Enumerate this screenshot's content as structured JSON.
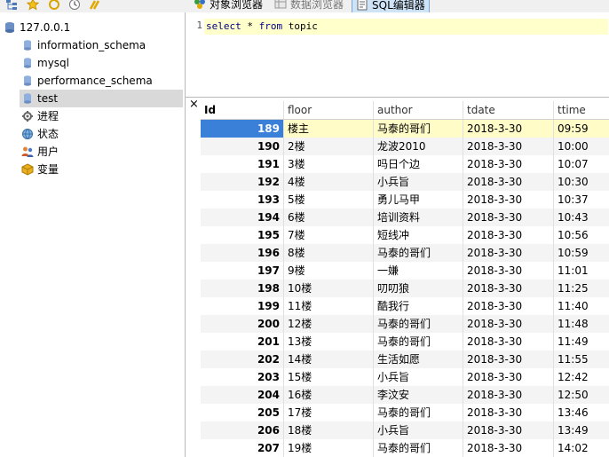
{
  "toolbar": {
    "icons": [
      "connection-tree-icon",
      "favorites-star-icon",
      "refresh-icon",
      "history-clock-icon",
      "tools-icon"
    ],
    "buttons": [
      {
        "label": "对象浏览器",
        "icon": "object-browser-icon",
        "state": "normal"
      },
      {
        "label": "数据浏览器",
        "icon": "data-browser-icon",
        "state": "disabled"
      },
      {
        "label": "SQL编辑器",
        "icon": "sql-editor-icon",
        "state": "active"
      }
    ]
  },
  "tree": {
    "server": "127.0.0.1",
    "databases": [
      "information_schema",
      "mysql",
      "performance_schema",
      "test"
    ],
    "selected_database": "test",
    "nodes": [
      "进程",
      "状态",
      "用户",
      "变量"
    ]
  },
  "editor": {
    "line_number": "1",
    "sql": {
      "select": "select",
      "star": "*",
      "from": "from",
      "table": "topic"
    }
  },
  "results": {
    "close": "×",
    "columns": [
      "Id",
      "floor",
      "author",
      "tdate",
      "ttime"
    ],
    "rows": [
      [
        "189",
        "楼主",
        "马泰的哥们",
        "2018-3-30",
        "09:59"
      ],
      [
        "190",
        "2楼",
        "龙波2010",
        "2018-3-30",
        "10:00"
      ],
      [
        "191",
        "3楼",
        "吗日个边",
        "2018-3-30",
        "10:07"
      ],
      [
        "192",
        "4楼",
        "小兵旨",
        "2018-3-30",
        "10:30"
      ],
      [
        "193",
        "5楼",
        "勇儿马甲",
        "2018-3-30",
        "10:37"
      ],
      [
        "194",
        "6楼",
        "培训资料",
        "2018-3-30",
        "10:43"
      ],
      [
        "195",
        "7楼",
        "短线冲",
        "2018-3-30",
        "10:56"
      ],
      [
        "196",
        "8楼",
        "马泰的哥们",
        "2018-3-30",
        "10:59"
      ],
      [
        "197",
        "9楼",
        "一嫌",
        "2018-3-30",
        "11:01"
      ],
      [
        "198",
        "10楼",
        "叨叨狼",
        "2018-3-30",
        "11:25"
      ],
      [
        "199",
        "11楼",
        "酷我行",
        "2018-3-30",
        "11:40"
      ],
      [
        "200",
        "12楼",
        "马泰的哥们",
        "2018-3-30",
        "11:48"
      ],
      [
        "201",
        "13楼",
        "马泰的哥们",
        "2018-3-30",
        "11:49"
      ],
      [
        "202",
        "14楼",
        "生活如愿",
        "2018-3-30",
        "11:55"
      ],
      [
        "203",
        "15楼",
        "小兵旨",
        "2018-3-30",
        "12:42"
      ],
      [
        "204",
        "16楼",
        "李汶安",
        "2018-3-30",
        "12:50"
      ],
      [
        "205",
        "17楼",
        "马泰的哥们",
        "2018-3-30",
        "13:46"
      ],
      [
        "206",
        "18楼",
        "小兵旨",
        "2018-3-30",
        "13:49"
      ],
      [
        "207",
        "19楼",
        "马泰的哥们",
        "2018-3-30",
        "14:02"
      ]
    ]
  }
}
